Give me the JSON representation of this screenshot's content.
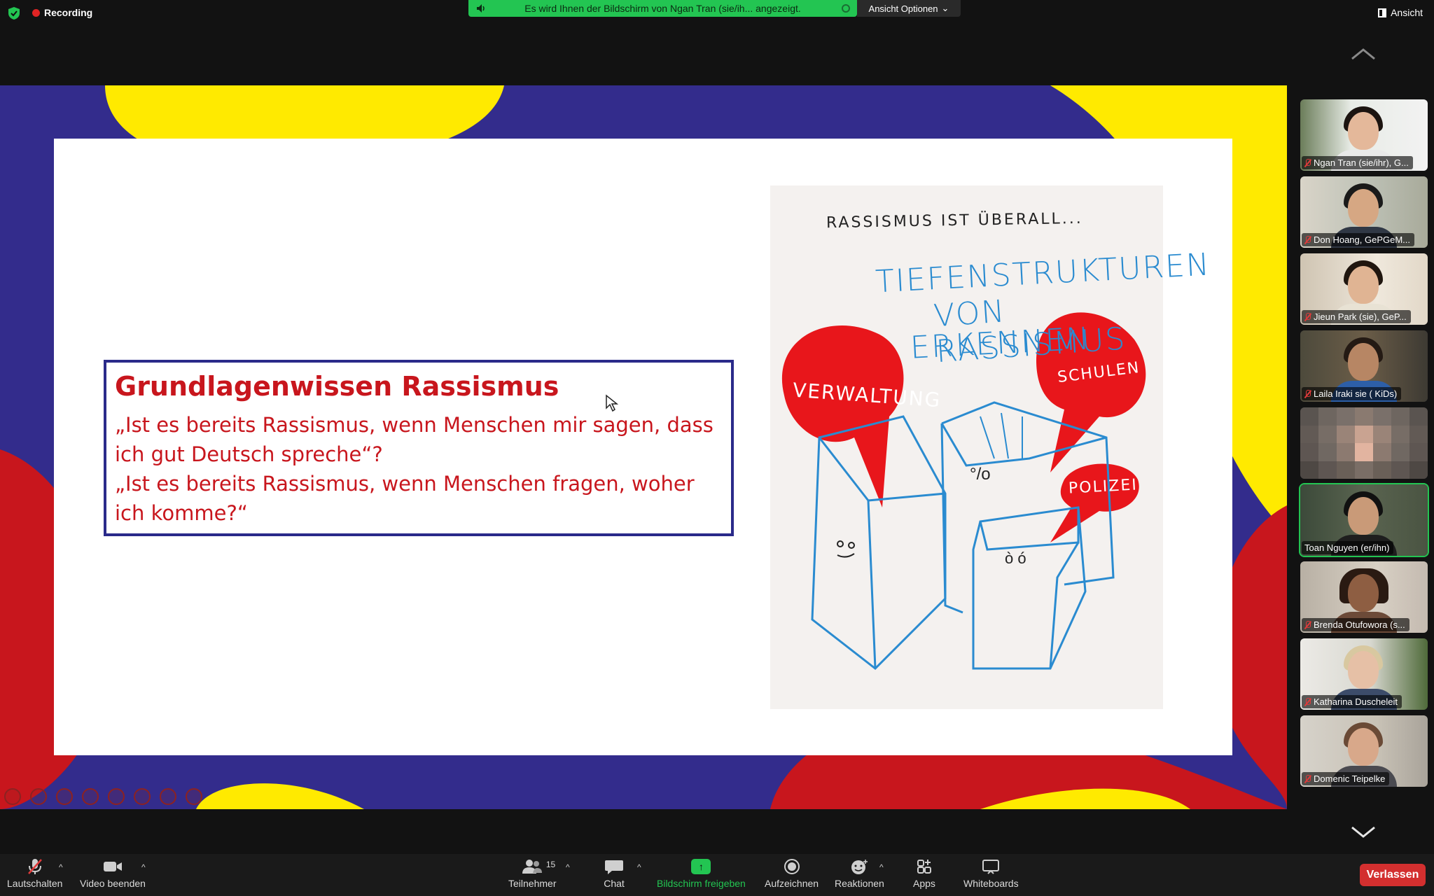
{
  "topbar": {
    "recording_label": "Recording",
    "share_banner": "Es wird Ihnen der Bildschirm von Ngan Tran (sie/ih... angezeigt.",
    "view_options": "Ansicht Optionen",
    "view_button": "Ansicht"
  },
  "slide": {
    "title": "Grundlagenwissen Rassismus",
    "quote_1": "  „Ist es bereits Rassismus, wenn Menschen mir sagen, dass ich gut Deutsch spreche“?",
    "quote_2": "„Ist es bereits Rassismus, wenn Menschen fragen, woher ich komme?“",
    "illustration": {
      "overline": "RASSISMUS IST ÜBERALL...",
      "heading_1": "TIEFENSTRUKTUREN",
      "heading_2": "VON RASSISMUS",
      "heading_3": "ERKENNEN",
      "label_1": "VERWALTUNG",
      "label_2": "SCHULEN",
      "label_3": "POLIZEI"
    }
  },
  "participants": [
    {
      "name": "Ngan Tran (sie/ihr), G...",
      "muted": true
    },
    {
      "name": "Don Hoang, GePGeM...",
      "muted": true
    },
    {
      "name": "Jieun Park (sie), GeP...",
      "muted": true
    },
    {
      "name": "Laila Iraki sie ( KiDs)",
      "muted": true
    },
    {
      "name": "",
      "muted": false
    },
    {
      "name": "Toan Nguyen (er/ihn)",
      "muted": false
    },
    {
      "name": "Brenda Otufowora  (s...",
      "muted": true
    },
    {
      "name": "Katharina Duscheleit",
      "muted": true
    },
    {
      "name": "Domenic Teipelke",
      "muted": true
    }
  ],
  "toolbar": {
    "mute": "Lautschalten",
    "video": "Video beenden",
    "participants": "Teilnehmer",
    "participant_count": "15",
    "chat": "Chat",
    "share": "Bildschirm freigeben",
    "record": "Aufzeichnen",
    "reactions": "Reaktionen",
    "apps": "Apps",
    "whiteboards": "Whiteboards",
    "leave": "Verlassen"
  },
  "colors": {
    "accent_green": "#23c552",
    "leave_red": "#d32f2f",
    "slide_red": "#c8161d",
    "slide_blue": "#332c8c",
    "slide_yellow": "#ffea00"
  }
}
